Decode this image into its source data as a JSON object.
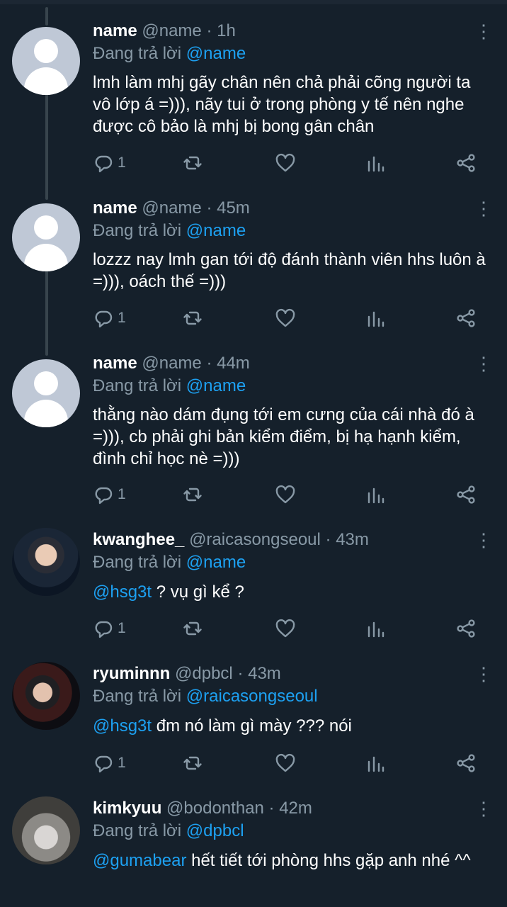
{
  "replying_prefix": "Đang trả lời",
  "tweets": [
    {
      "name": "name",
      "handle": "@name",
      "time": "· 1h",
      "reply_to": "@name",
      "text": "lmh làm mhj gãy chân nên chả phải cõng người ta vô lớp á =))), nãy tui ở trong phòng y tế nên nghe được cô bảo là mhj bị bong gân chân",
      "mention": "",
      "reply_count": "1"
    },
    {
      "name": "name",
      "handle": "@name",
      "time": "· 45m",
      "reply_to": "@name",
      "text": "lozzz nay lmh gan tới độ đánh thành viên hhs luôn à =))), oách thế =)))",
      "mention": "",
      "reply_count": "1"
    },
    {
      "name": "name",
      "handle": "@name",
      "time": "· 44m",
      "reply_to": "@name",
      "text": "thằng nào dám đụng tới em cưng của cái nhà đó à =))), cb phải ghi bản kiểm điểm, bị hạ hạnh kiểm, đình chỉ học nè =)))",
      "mention": "",
      "reply_count": "1"
    },
    {
      "name": "kwanghee_",
      "handle": "@raicasongseoul",
      "time": "· 43m",
      "reply_to": "@name",
      "mention": "@hsg3t",
      "text": " ? vụ gì kể ?",
      "reply_count": "1"
    },
    {
      "name": "ryuminnn",
      "handle": "@dpbcl",
      "time": "· 43m",
      "reply_to": "@raicasongseoul",
      "mention": "@hsg3t",
      "text": " đm nó làm gì mày ??? nói",
      "reply_count": "1"
    },
    {
      "name": "kimkyuu",
      "handle": "@bodonthan",
      "time": "· 42m",
      "reply_to": "@dpbcl",
      "mention": "@gumabear",
      "text": " hết tiết tới phòng hhs gặp anh nhé ^^",
      "reply_count": ""
    }
  ],
  "icons": [
    "reply-icon",
    "retweet-icon",
    "like-icon",
    "stats-icon",
    "share-icon",
    "more-icon"
  ],
  "colors": {
    "background": "#15202b",
    "accent": "#1da1f2",
    "muted": "#8899a6"
  }
}
